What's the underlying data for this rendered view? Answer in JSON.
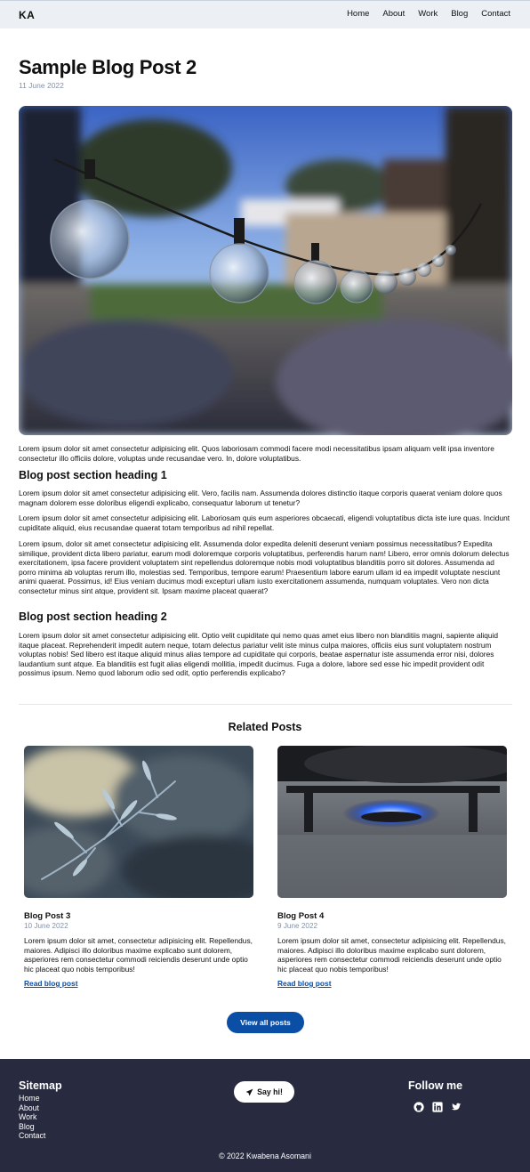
{
  "header": {
    "logo": "KA",
    "nav": [
      "Home",
      "About",
      "Work",
      "Blog",
      "Contact"
    ]
  },
  "post": {
    "title": "Sample Blog Post 2",
    "date": "11 June 2022",
    "hero_image": "outdoor string light bulbs",
    "intro": "Lorem ipsum dolor sit amet consectetur adipisicing elit. Quos laboriosam commodi facere modi necessitatibus ipsam aliquam velit ipsa inventore consectetur illo officiis dolore, voluptas unde recusandae vero. In, dolore voluptatibus.",
    "section1_heading": "Blog post section heading 1",
    "section1_p1": "Lorem ipsum dolor sit amet consectetur adipisicing elit. Vero, facilis nam. Assumenda dolores distinctio itaque corporis quaerat veniam dolore quos magnam dolorem esse doloribus eligendi explicabo, consequatur laborum ut tenetur?",
    "section1_p2": "Lorem ipsum dolor sit amet consectetur adipisicing elit. Laboriosam quis eum asperiores obcaecati, eligendi voluptatibus dicta iste iure quas. Incidunt cupiditate aliquid, eius recusandae quaerat totam temporibus ad nihil repellat.",
    "section1_p3": "Lorem ipsum, dolor sit amet consectetur adipisicing elit. Assumenda dolor expedita deleniti deserunt veniam possimus necessitatibus? Expedita similique, provident dicta libero pariatur, earum modi doloremque corporis voluptatibus, perferendis harum nam! Libero, error omnis dolorum delectus exercitationem, ipsa facere provident voluptatem sint repellendus doloremque nobis modi voluptatibus blanditiis porro sit dolores. Assumenda ad porro minima ab voluptas rerum illo, molestias sed. Temporibus, tempore earum! Praesentium labore earum ullam id ea impedit voluptate nesciunt animi quaerat. Possimus, id! Eius veniam ducimus modi excepturi ullam iusto exercitationem assumenda, numquam voluptates. Vero non dicta consectetur minus sint atque, provident sit. Ipsam maxime placeat quaerat?",
    "section2_heading": "Blog post section heading 2",
    "section2_p1": "Lorem ipsum dolor sit amet consectetur adipisicing elit. Optio velit cupiditate qui nemo quas amet eius libero non blanditiis magni, sapiente aliquid itaque placeat. Reprehenderit impedit autem neque, totam delectus pariatur velit iste minus culpa maiores, officiis eius sunt voluptatem nostrum voluptas nobis! Sed libero est itaque aliquid minus alias tempore ad cupiditate qui corporis, beatae aspernatur iste assumenda error nisi, dolores laudantium sunt atque. Ea blanditiis est fugit alias eligendi mollitia, impedit ducimus. Fuga a dolore, labore sed esse hic impedit provident odit possimus ipsum. Nemo quod laborum odio sed odit, optio perferendis explicabo?"
  },
  "related": {
    "title": "Related Posts",
    "cards": [
      {
        "title": "Blog Post 3",
        "date": "10 June 2022",
        "excerpt": "Lorem ipsum dolor sit amet, consectetur adipisicing elit. Repellendus, maiores. Adipisci illo doloribus maxime explicabo sunt dolorem, asperiores rem consectetur commodi reiciendis deserunt unde optio hic placeat quo nobis temporibus!",
        "link": "Read blog post",
        "image": "olive branch"
      },
      {
        "title": "Blog Post 4",
        "date": "9 June 2022",
        "excerpt": "Lorem ipsum dolor sit amet, consectetur adipisicing elit. Repellendus, maiores. Adipisci illo doloribus maxime explicabo sunt dolorem, asperiores rem consectetur commodi reiciendis deserunt unde optio hic placeat quo nobis temporibus!",
        "link": "Read blog post",
        "image": "gas stove burner"
      }
    ],
    "view_all": "View all posts"
  },
  "footer": {
    "sitemap_title": "Sitemap",
    "sitemap": [
      "Home",
      "About",
      "Work",
      "Blog",
      "Contact"
    ],
    "say_hi": "Say hi!",
    "say_hi_icon": "paper-plane-icon",
    "follow_title": "Follow me",
    "socials": [
      "github-icon",
      "linkedin-icon",
      "twitter-icon"
    ],
    "copyright": "© 2022 Kwabena Asomani"
  },
  "colors": {
    "accent": "#0a4ea6",
    "footer_bg": "#282b3f",
    "header_bg": "#eceff3",
    "date_text": "#8292aa"
  }
}
